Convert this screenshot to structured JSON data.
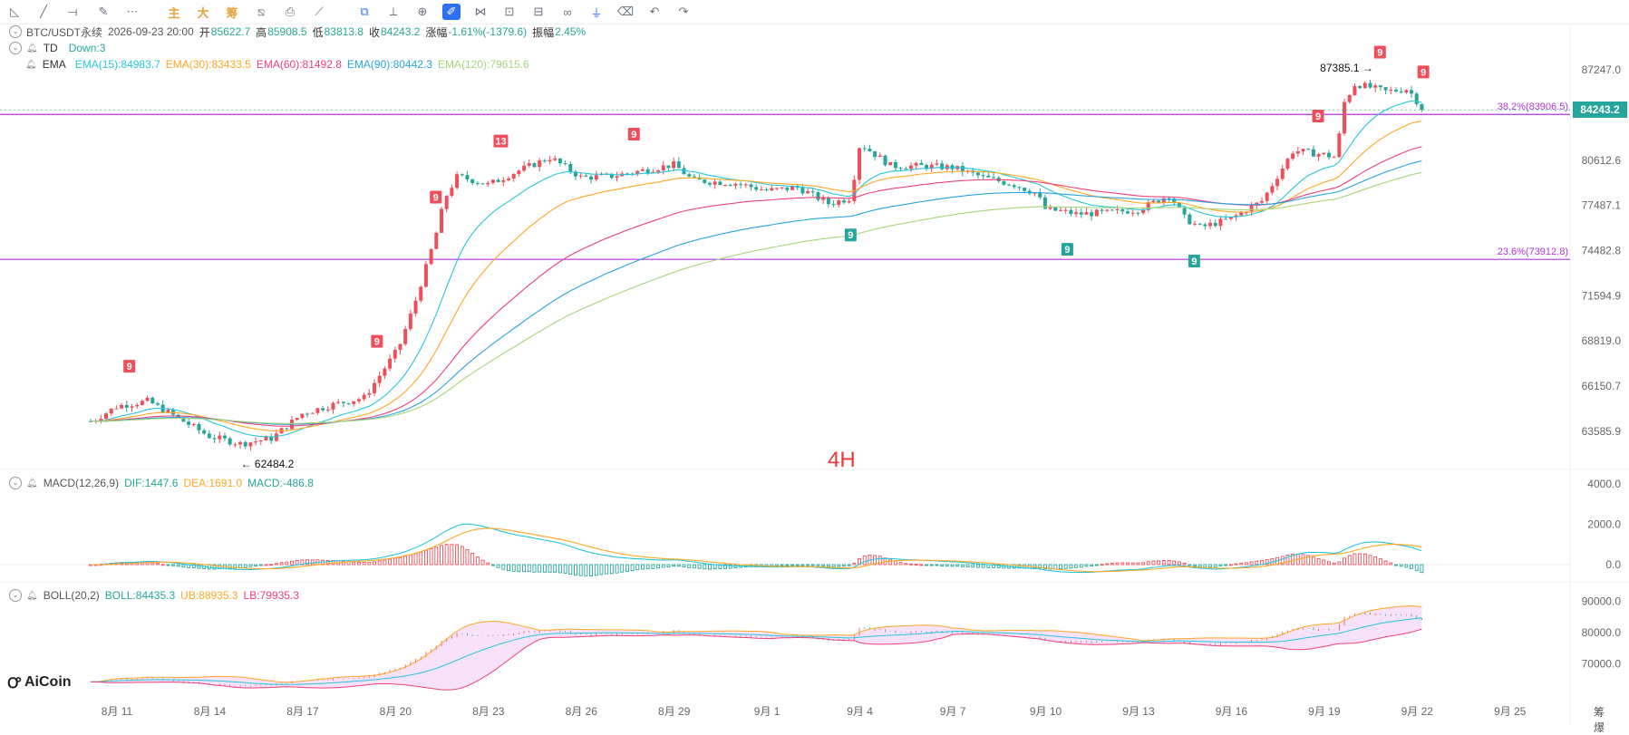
{
  "toolbar": {
    "tools": [
      {
        "id": "trend-line",
        "glyph": "◺",
        "x": 6
      },
      {
        "id": "ray-line",
        "glyph": "╱",
        "x": 38
      },
      {
        "id": "h-line",
        "glyph": "⟞",
        "x": 70
      },
      {
        "id": "brush",
        "glyph": "✎",
        "x": 104
      },
      {
        "id": "more",
        "glyph": "⋯",
        "x": 136
      },
      {
        "id": "main",
        "glyph": "主",
        "x": 182,
        "cn": true
      },
      {
        "id": "big",
        "glyph": "大",
        "x": 214,
        "cn": true
      },
      {
        "id": "chip",
        "glyph": "筹",
        "x": 246,
        "cn": true
      },
      {
        "id": "calc",
        "glyph": "⧅",
        "x": 278
      },
      {
        "id": "snapshot",
        "glyph": "⎙",
        "x": 310
      },
      {
        "id": "draw-sync",
        "glyph": "⟋",
        "x": 342
      },
      {
        "id": "copy",
        "glyph": "⧉",
        "x": 392,
        "blue": true
      },
      {
        "id": "ruler",
        "glyph": "⟂",
        "x": 424
      },
      {
        "id": "zoom",
        "glyph": "⊕",
        "x": 456
      },
      {
        "id": "pen",
        "glyph": "✐",
        "x": 488,
        "active": true
      },
      {
        "id": "magnet",
        "glyph": "⋈",
        "x": 520
      },
      {
        "id": "lock",
        "glyph": "⊡",
        "x": 552
      },
      {
        "id": "hide",
        "glyph": "⊟",
        "x": 584
      },
      {
        "id": "link",
        "glyph": "∞",
        "x": 616
      },
      {
        "id": "filter",
        "glyph": "⏚",
        "x": 648,
        "blue": true
      },
      {
        "id": "delete",
        "glyph": "⌫",
        "x": 680
      },
      {
        "id": "undo",
        "glyph": "↶",
        "x": 712
      },
      {
        "id": "redo",
        "glyph": "↷",
        "x": 744
      }
    ]
  },
  "header": {
    "symbol": "BTC/USDT永续",
    "datetime": "2026-09-23 20:00",
    "open_label": "开",
    "open": "85622.7",
    "high_label": "高",
    "high": "85908.5",
    "low_label": "低",
    "low": "83813.8",
    "close_label": "收",
    "close": "84243.2",
    "change_label": "涨幅",
    "change": "-1.61%(-1379.6)",
    "amp_label": "振幅",
    "amp": "2.45%"
  },
  "td": {
    "label": "TD",
    "value": "Down:3"
  },
  "ema": {
    "label": "EMA",
    "items": [
      {
        "text": "EMA(15):84983.7",
        "color": "#26c6da"
      },
      {
        "text": "EMA(30):83433.5",
        "color": "#ffa726"
      },
      {
        "text": "EMA(60):81492.8",
        "color": "#ec407a"
      },
      {
        "text": "EMA(90):80442.3",
        "color": "#29a3e0"
      },
      {
        "text": "EMA(120):79615.6",
        "color": "#a5d67b"
      }
    ]
  },
  "macd_header": {
    "label": "MACD(12,26,9)",
    "dif": "DIF:1447.6",
    "dea": "DEA:1691.0",
    "macd": "MACD:-486.8"
  },
  "boll_header": {
    "label": "BOLL(20,2)",
    "boll": "BOLL:84435.3",
    "ub": "UB:88935.3",
    "lb": "LB:79935.3"
  },
  "timeframe": "4H",
  "brand": "AiCoin",
  "current_price": "84243.2",
  "corner_text": "筹 爆",
  "colors": {
    "up": "#ef4f5a",
    "down": "#26a69a",
    "fib": "#b336d6"
  },
  "chart_data": {
    "type": "candlestick",
    "interval": "4H",
    "price_axis": {
      "ticks": [
        "87247.0",
        "80612.6",
        "77487.1",
        "74482.8",
        "71594.9",
        "68819.0",
        "66150.7",
        "63585.9"
      ]
    },
    "macd_axis": {
      "ticks": [
        "4000.0",
        "2000.0",
        "0.0"
      ]
    },
    "boll_axis": {
      "ticks": [
        "90000.0",
        "80000.0",
        "70000.0"
      ]
    },
    "x_ticks": [
      "8月 11",
      "8月 14",
      "8月 17",
      "8月 20",
      "8月 23",
      "8月 26",
      "8月 29",
      "9月 1",
      "9月 4",
      "9月 7",
      "9月 10",
      "9月 13",
      "9月 16",
      "9月 19",
      "9月 22",
      "9月 25"
    ],
    "fib_levels": [
      {
        "label": "38.2%(83906.5)",
        "value": 83906.5
      },
      {
        "label": "23.6%(73912.8)",
        "value": 73912.8
      }
    ],
    "annotations": {
      "high": "87385.1",
      "low": "62484.2"
    },
    "td_marks": [
      {
        "day": 0.4,
        "text": "9",
        "side": "up"
      },
      {
        "day": 8.4,
        "text": "9",
        "side": "up"
      },
      {
        "day": 10.3,
        "text": "9",
        "side": "up"
      },
      {
        "day": 12.4,
        "text": "13",
        "side": "up"
      },
      {
        "day": 16.7,
        "text": "9",
        "side": "up"
      },
      {
        "day": 23.7,
        "text": "9",
        "side": "down"
      },
      {
        "day": 30.7,
        "text": "9",
        "side": "down"
      },
      {
        "day": 34.8,
        "text": "9",
        "side": "down"
      },
      {
        "day": 38.8,
        "text": "9",
        "side": "up"
      },
      {
        "day": 40.8,
        "text": "9",
        "side": "up"
      },
      {
        "day": 42.2,
        "text": "9",
        "side": "up"
      }
    ],
    "close_path": [
      [
        -0.8,
        64150
      ],
      [
        0,
        65000
      ],
      [
        1,
        65300
      ],
      [
        2,
        64300
      ],
      [
        3,
        63300
      ],
      [
        4,
        62900
      ],
      [
        5,
        63200
      ],
      [
        6,
        64600
      ],
      [
        7,
        65100
      ],
      [
        8,
        65500
      ],
      [
        9.1,
        68400
      ],
      [
        9.6,
        71000
      ],
      [
        10,
        73500
      ],
      [
        10.3,
        75500
      ],
      [
        10.6,
        78000
      ],
      [
        11,
        79500
      ],
      [
        12,
        78900
      ],
      [
        13,
        79900
      ],
      [
        14,
        80800
      ],
      [
        15,
        79400
      ],
      [
        16,
        79500
      ],
      [
        17,
        79900
      ],
      [
        18,
        80300
      ],
      [
        18.6,
        79200
      ],
      [
        20,
        79000
      ],
      [
        21,
        78500
      ],
      [
        22,
        78700
      ],
      [
        23,
        77600
      ],
      [
        23.7,
        78000
      ],
      [
        24,
        81800
      ],
      [
        25,
        80200
      ],
      [
        26,
        80200
      ],
      [
        27,
        80100
      ],
      [
        28,
        79400
      ],
      [
        29,
        78900
      ],
      [
        29.7,
        78300
      ],
      [
        30,
        77200
      ],
      [
        30.5,
        77100
      ],
      [
        31,
        76900
      ],
      [
        32,
        77000
      ],
      [
        33,
        77200
      ],
      [
        34,
        78200
      ],
      [
        34.5,
        76600
      ],
      [
        35,
        76000
      ],
      [
        36,
        76600
      ],
      [
        37,
        77800
      ],
      [
        38,
        81300
      ],
      [
        39,
        81000
      ],
      [
        39.4,
        80800
      ],
      [
        39.6,
        84600
      ],
      [
        40,
        86200
      ],
      [
        41,
        85600
      ],
      [
        41.7,
        85800
      ],
      [
        42.2,
        84243
      ]
    ],
    "ema_final": {
      "ema15": 84983.7,
      "ema30": 83433.5,
      "ema60": 81492.8,
      "ema90": 80442.3,
      "ema120": 79615.6
    },
    "macd_final": {
      "dif": 1447.6,
      "dea": 1691.0,
      "macd": -486.8
    },
    "boll_final": {
      "mid": 84435.3,
      "upper": 88935.3,
      "lower": 79935.3
    }
  }
}
